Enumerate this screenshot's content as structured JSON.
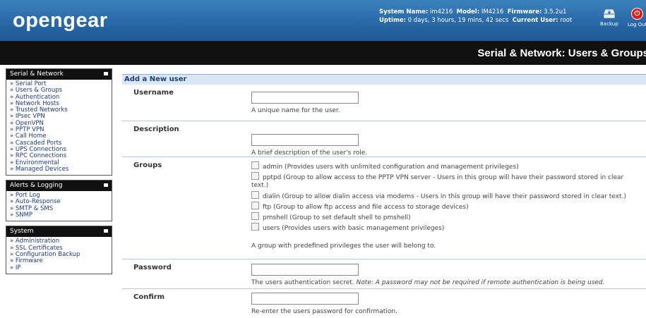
{
  "header": {
    "logo": "opengear",
    "system_name_label": "System Name:",
    "system_name": "im4216",
    "model_label": "Model:",
    "model": "IM4216",
    "firmware_label": "Firmware:",
    "firmware": "3.5.2u1",
    "uptime_label": "Uptime:",
    "uptime": "0 days, 3 hours, 19 mins, 42 secs",
    "current_user_label": "Current User:",
    "current_user": "root",
    "backup_label": "Backup",
    "logout_label": "Log Out"
  },
  "page_title": "Serial & Network: Users & Groups",
  "sidebar": {
    "menus": [
      {
        "title": "Serial & Network",
        "items": [
          "Serial Port",
          "Users & Groups",
          "Authentication",
          "Network Hosts",
          "Trusted Networks",
          "IPsec VPN",
          "OpenVPN",
          "PPTP VPN",
          "Call Home",
          "Cascaded Ports",
          "UPS Connections",
          "RPC Connections",
          "Environmental",
          "Managed Devices"
        ]
      },
      {
        "title": "Alerts & Logging",
        "items": [
          "Port Log",
          "Auto-Response",
          "SMTP & SMS",
          "SNMP"
        ]
      },
      {
        "title": "System",
        "items": [
          "Administration",
          "SSL Certificates",
          "Configuration Backup",
          "Firmware",
          "IP"
        ]
      }
    ]
  },
  "form": {
    "heading": "Add a New user",
    "username": {
      "label": "Username",
      "value": "",
      "help": "A unique name for the user."
    },
    "description": {
      "label": "Description",
      "value": "",
      "help": "A brief description of the user's role."
    },
    "groups": {
      "label": "Groups",
      "options": [
        "admin (Provides users with unlimited configuration and management privileges)",
        "pptpd (Group to allow access to the PPTP VPN server - Users in this group will have their password stored in clear",
        "text.)",
        "dialin (Group to allow dialin access via modems - Users in this group will have their password stored in clear text.)",
        "ftp (Group to allow ftp access and file access to storage devices)",
        "pmshell (Group to set default shell to pmshell)",
        "users (Provides users with basic management privileges)"
      ],
      "help": "A group with predefined privileges the user will belong to."
    },
    "password": {
      "label": "Password",
      "value": "",
      "help": "The users authentication secret.",
      "note": "Note: A password may not be required if remote authentication is being used."
    },
    "confirm": {
      "label": "Confirm",
      "value": "",
      "help": "Re-enter the users password for confirmation."
    }
  }
}
